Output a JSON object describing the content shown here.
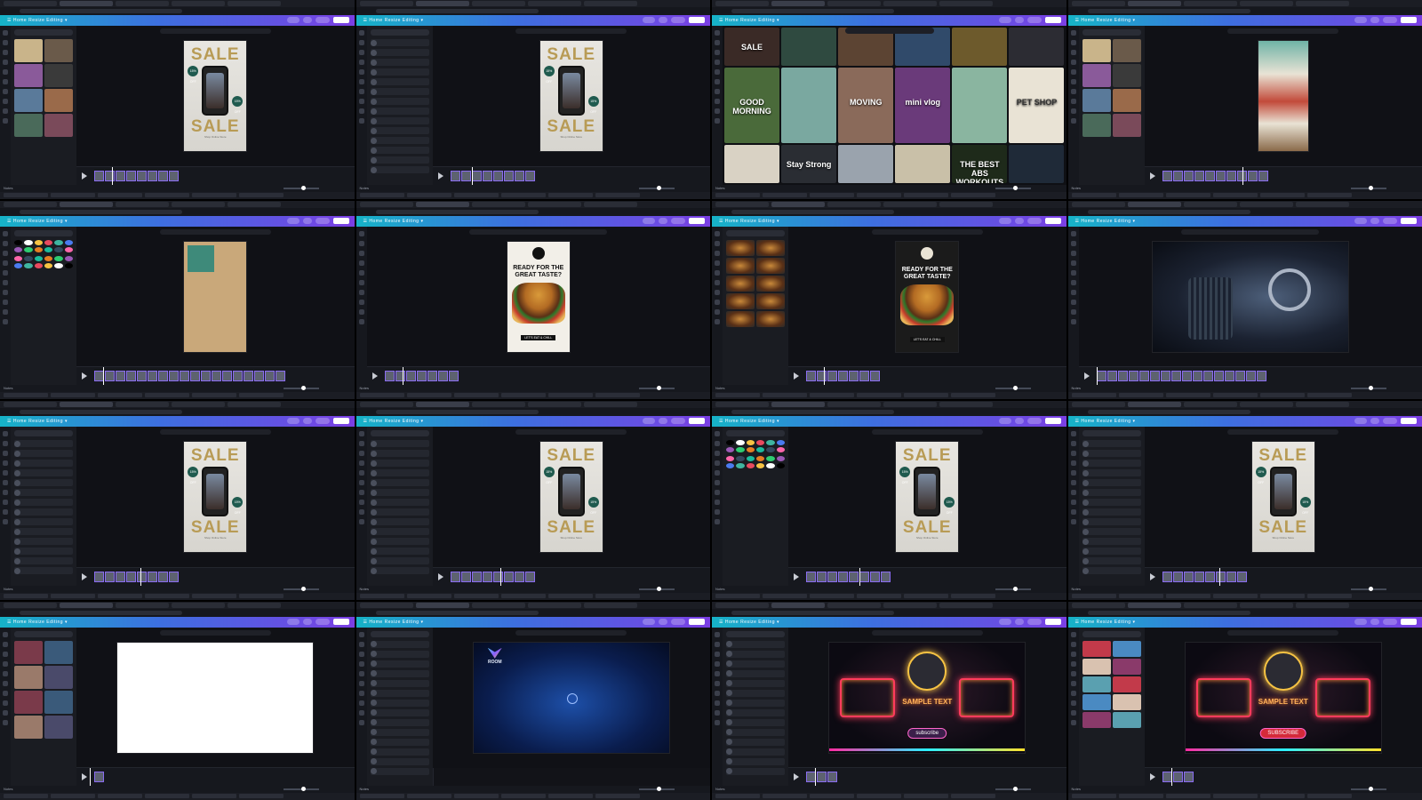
{
  "grid_title": "",
  "editor": {
    "menu": "☰  Home   Resize   Editing ▾",
    "share_label": "Share",
    "notes_label": "Notes",
    "duration_label": "Duration"
  },
  "cells": [
    {
      "type": "sale",
      "theme": "design"
    },
    {
      "type": "sale",
      "theme": "audio"
    },
    {
      "type": "photogrid",
      "tiles": [
        {
          "label": "SALE",
          "color": "#3a2a26"
        },
        {
          "label": "",
          "color": "#2f4a40"
        },
        {
          "label": "",
          "color": "#5c4433"
        },
        {
          "label": "",
          "color": "#304a6a"
        },
        {
          "label": "",
          "color": "#6d5a2c"
        },
        {
          "label": "",
          "color": "#2c2c33"
        },
        {
          "label": "GOOD MORNING",
          "color": "#4a6a3a"
        },
        {
          "label": "",
          "color": "#7aa8a0"
        },
        {
          "label": "MOVING",
          "color": "#8a6a5a"
        },
        {
          "label": "mini vlog",
          "color": "#6a3a7a"
        },
        {
          "label": "",
          "color": "#8ab5a0"
        },
        {
          "label": "PET SHOP",
          "color": "#e9e3d5"
        },
        {
          "label": "",
          "color": "#d9d2c4"
        },
        {
          "label": "Stay Strong",
          "color": "#2a2d33"
        },
        {
          "label": "",
          "color": "#9aa3ad"
        },
        {
          "label": "",
          "color": "#c9c0a8"
        },
        {
          "label": "THE BEST ABS WORKOUTS",
          "color": "#1e2a1a"
        },
        {
          "label": "",
          "color": "#1f2a38"
        }
      ]
    },
    {
      "type": "collage"
    },
    {
      "type": "color"
    },
    {
      "type": "burger",
      "title": "READY FOR THE GREAT TASTE?",
      "cta": "LET'S EAT & CHILL"
    },
    {
      "type": "burger_panel",
      "title": "READY FOR THE GREAT TASTE?",
      "cta": "LET'S EAT & CHILL"
    },
    {
      "type": "projector"
    },
    {
      "type": "sale",
      "theme": "uploads"
    },
    {
      "type": "sale",
      "theme": "audio"
    },
    {
      "type": "sale",
      "theme": "color"
    },
    {
      "type": "sale",
      "theme": "plain"
    },
    {
      "type": "blank"
    },
    {
      "type": "room",
      "brand": "ROOM"
    },
    {
      "type": "neon",
      "text": "SAMPLE TEXT",
      "btn": "subscribe",
      "btn_color": "#3b1f4a"
    },
    {
      "type": "neon",
      "text": "SAMPLE TEXT",
      "btn": "SUBSCRIBE",
      "btn_color": "#d42a3a"
    }
  ],
  "sale": {
    "top": "SALE",
    "bottom": "SALE",
    "badge": "15% OFF",
    "caption": "Shop Online Store"
  },
  "swatches": [
    "#000000",
    "#ffffff",
    "#f6c343",
    "#e84a5f",
    "#3fb5a0",
    "#4a7bf0",
    "#9b59b6",
    "#2ecc71",
    "#e67e22",
    "#1abc9c",
    "#34495e",
    "#ff66aa"
  ]
}
